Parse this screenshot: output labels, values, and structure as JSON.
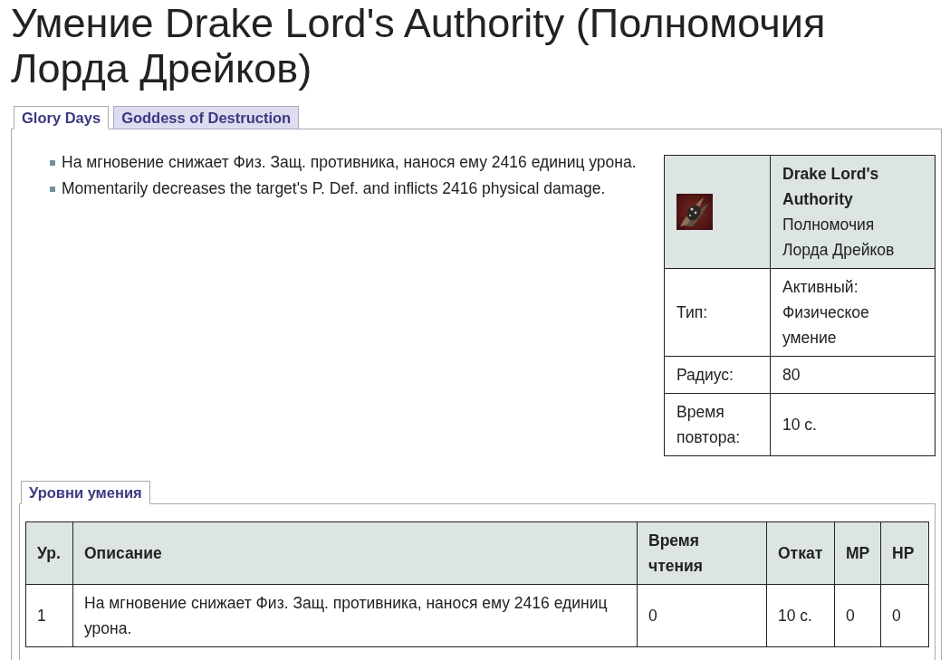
{
  "title": "Умение Drake Lord's Authority (Полномочия Лорда Дрейков)",
  "tabs": [
    {
      "label": "Glory Days",
      "selected": true
    },
    {
      "label": "Goddess of Destruction",
      "selected": false
    }
  ],
  "description": [
    "На мгновение снижает Физ. Защ. противника, нанося ему 2416 единиц урона.",
    "Momentarily decreases the target's P. Def. and inflicts 2416 physical damage."
  ],
  "info_box": {
    "name": "Drake Lord's Authority",
    "name_translation": "Полномочия Лорда Дрейков",
    "rows": [
      {
        "label": "Тип:",
        "value": "Активный: Физическое умение"
      },
      {
        "label": "Радиус:",
        "value": "80"
      },
      {
        "label": "Время повтора:",
        "value": "10 с."
      }
    ]
  },
  "levels_section": {
    "tabs": [
      {
        "label": "Уровни умения",
        "selected": true
      }
    ],
    "table": {
      "columns": [
        "Ур.",
        "Описание",
        "Время чтения",
        "Откат",
        "MP",
        "HP"
      ],
      "rows": [
        [
          "1",
          "На мгновение снижает Физ. Защ. противника, нанося ему 2416 единиц урона.",
          "0",
          "10 с.",
          "0",
          "0"
        ]
      ]
    }
  }
}
